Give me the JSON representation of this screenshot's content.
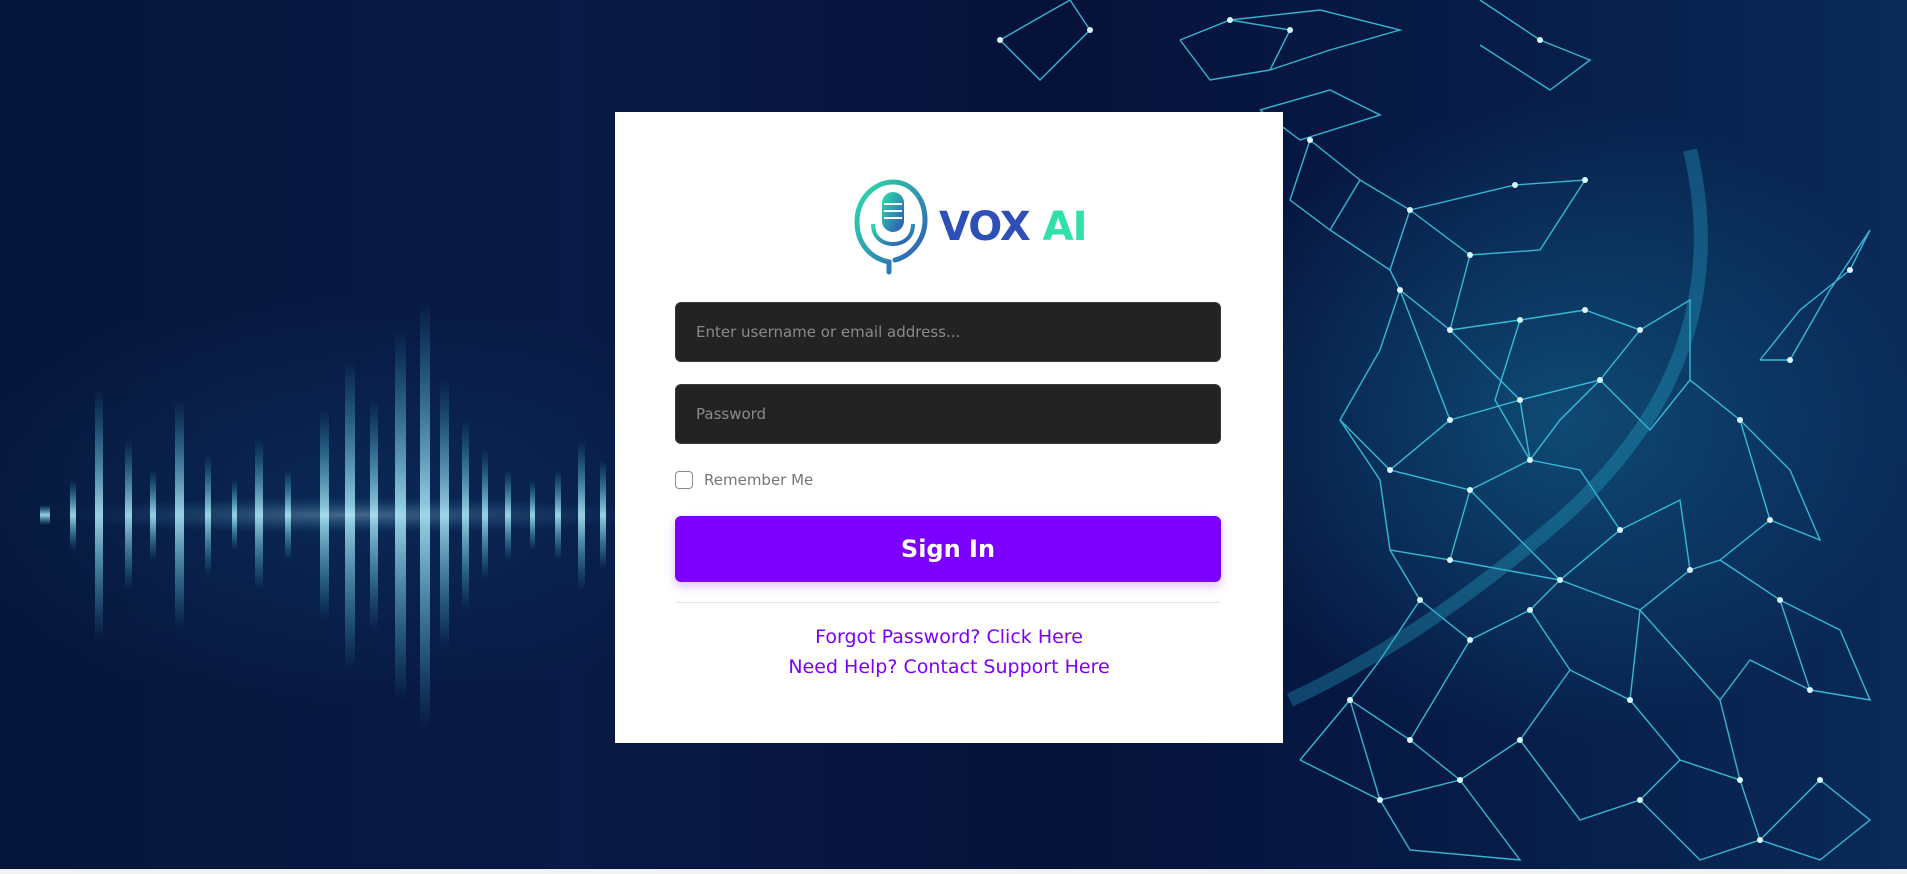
{
  "background": {
    "accent_color": "#34c6e0",
    "base_color": "#07143c"
  },
  "logo": {
    "brand_primary": "VOX",
    "brand_secondary": "AI",
    "icon": "microphone-icon",
    "primary_color": "#2f4fb8",
    "secondary_color": "#2fe0a8"
  },
  "login": {
    "username_placeholder": "Enter username or email address...",
    "password_placeholder": "Password",
    "remember_label": "Remember Me",
    "signin_label": "Sign In",
    "forgot_link": "Forgot Password? Click Here",
    "help_link": "Need Help? Contact Support Here",
    "accent_color": "#7b00ff",
    "field_color": "#232323"
  }
}
